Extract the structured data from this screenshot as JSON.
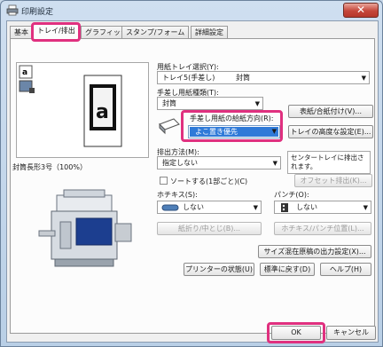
{
  "window": {
    "title": "印刷設定",
    "close_label": "✕"
  },
  "tabs": [
    "基本",
    "トレイ/排出",
    "グラフィックス",
    "スタンプ/フォーム",
    "詳細設定"
  ],
  "paper_tray": {
    "label": "用紙トレイ選択(Y):",
    "value_tray": "トレイ5(手差し)",
    "value_paper": "封筒"
  },
  "manual_paper_type": {
    "label": "手差し用紙種類(T):",
    "value": "封筒"
  },
  "feed_direction": {
    "label": "手差し用紙の給紙方向(R):",
    "value": "よこ置き優先"
  },
  "buttons": {
    "cover": "表紙/合紙付け(V)...",
    "tray_advanced": "トレイの高度な設定(E)...",
    "offset": "オフセット排出(K)...",
    "fold": "紙折り/中とじ(B)...",
    "staple_punch_pos": "ホチキス/パンチ位置(L)...",
    "mixed_size": "サイズ混在原稿の出力設定(X)...",
    "printer_status": "プリンターの状態(U)",
    "restore_default": "標準に戻す(D)",
    "help": "ヘルプ(H)",
    "ok": "OK",
    "cancel": "キャンセル"
  },
  "preview": {
    "caption": "封筒長形3号（100%）",
    "page_letter": "a"
  },
  "output": {
    "label": "排出方法(M):",
    "value": "指定しない"
  },
  "output_note": "センタートレイに排出されます。",
  "collate": {
    "label": "ソートする(1部ごと)(C)"
  },
  "staple": {
    "label": "ホチキス(S):",
    "value": "しない"
  },
  "punch": {
    "label": "パンチ(O):",
    "value": "しない"
  },
  "colors": {
    "highlight": "#e0307f",
    "selection": "#2f7ad8"
  }
}
